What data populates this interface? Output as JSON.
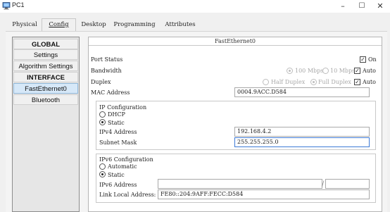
{
  "window": {
    "title": "PC1",
    "minimize": "–",
    "maximize": "☐",
    "close": "✕"
  },
  "tabs": [
    {
      "label": "Physical"
    },
    {
      "label": "Config"
    },
    {
      "label": "Desktop"
    },
    {
      "label": "Programming"
    },
    {
      "label": "Attributes"
    }
  ],
  "nav": {
    "items": [
      {
        "label": "GLOBAL"
      },
      {
        "label": "Settings"
      },
      {
        "label": "Algorithm Settings"
      },
      {
        "label": "INTERFACE"
      },
      {
        "label": "FastEthernet0"
      },
      {
        "label": "Bluetooth"
      }
    ]
  },
  "panel": {
    "title": "FastEthernet0",
    "port_status": {
      "label": "Port Status",
      "on_label": "On",
      "checked": true
    },
    "bandwidth": {
      "label": "Bandwidth",
      "opt1": "100 Mbps",
      "opt2": "10 Mbps",
      "auto_label": "Auto",
      "auto_checked": true
    },
    "duplex": {
      "label": "Duplex",
      "opt1": "Half Duplex",
      "opt2": "Full Duplex",
      "auto_label": "Auto",
      "auto_checked": true
    },
    "mac": {
      "label": "MAC Address",
      "value": "0004.9ACC.D584"
    },
    "ipv4": {
      "title": "IP Configuration",
      "dhcp_label": "DHCP",
      "static_label": "Static",
      "mode": "static",
      "address_label": "IPv4 Address",
      "address_value": "192.168.4.2",
      "mask_label": "Subnet Mask",
      "mask_value": "255.255.255.0"
    },
    "ipv6": {
      "title": "IPv6 Configuration",
      "auto_label": "Automatic",
      "static_label": "Static",
      "mode": "static",
      "address_label": "IPv6 Address",
      "address_value": "",
      "separator": "/",
      "prefix_value": "",
      "link_local_label": "Link Local Address:",
      "link_local_value": "FE80::204:9AFF:FECC:D584"
    }
  },
  "colors": {
    "selected_nav": "#d6e8f8",
    "focus_border": "#3d7ad6",
    "panel_bg": "#ffffff"
  }
}
